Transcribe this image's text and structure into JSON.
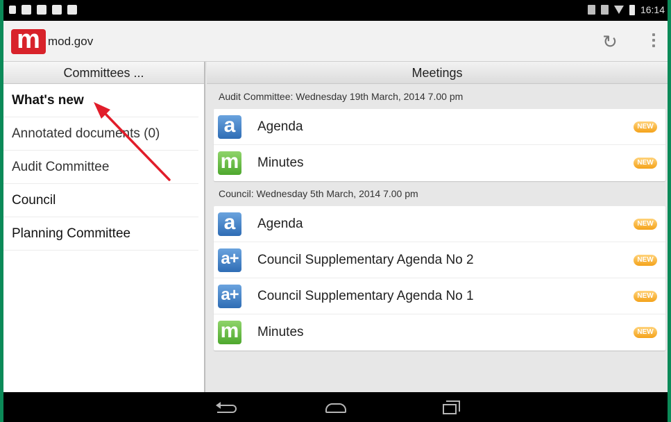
{
  "status_bar": {
    "time": "16:14"
  },
  "app": {
    "name": "mod.gov",
    "logo_letter": "m"
  },
  "actions": {
    "refresh_icon": "refresh-icon",
    "overflow_icon": "overflow-menu-icon"
  },
  "left_pane": {
    "header": "Committees ...",
    "items": [
      {
        "label": "What's new"
      },
      {
        "label": "Annotated documents (0)"
      },
      {
        "label": "Audit Committee"
      },
      {
        "label": "Council"
      },
      {
        "label": "Planning Committee"
      }
    ]
  },
  "right_pane": {
    "header": "Meetings",
    "groups": [
      {
        "title": "Audit Committee: Wednesday 19th March, 2014 7.00 pm",
        "rows": [
          {
            "icon_letter": "a",
            "label": "Agenda",
            "badge": "NEW"
          },
          {
            "icon_letter": "m",
            "label": "Minutes",
            "badge": "NEW"
          }
        ]
      },
      {
        "title": "Council: Wednesday 5th March, 2014 7.00 pm",
        "rows": [
          {
            "icon_letter": "a",
            "label": "Agenda",
            "badge": "NEW"
          },
          {
            "icon_letter": "a+",
            "label": "Council Supplementary Agenda No 2",
            "badge": "NEW"
          },
          {
            "icon_letter": "a+",
            "label": "Council Supplementary Agenda No 1",
            "badge": "NEW"
          },
          {
            "icon_letter": "m",
            "label": "Minutes",
            "badge": "NEW"
          }
        ]
      }
    ]
  },
  "colors": {
    "brand": "#d8222a",
    "agenda": "#2f6db5",
    "minutes": "#4ea82e",
    "badge": "#f4a21a",
    "annotation_arrow": "#e11d2a"
  }
}
